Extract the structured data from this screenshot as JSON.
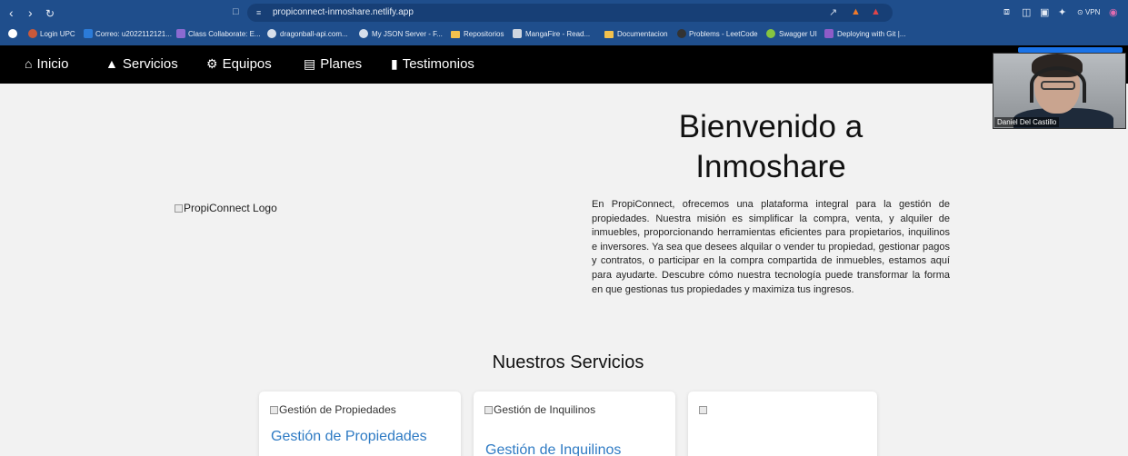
{
  "browser": {
    "url": "propiconnect-inmoshare.netlify.app",
    "vpn_label": "VPN",
    "bookmarks": [
      "Login UPC",
      "Correo: u2022112121...",
      "Class Collaborate: E...",
      "dragonball-api.com...",
      "My JSON Server - F...",
      "Repositorios",
      "MangaFire - Read...",
      "Documentacion",
      "Problems - LeetCode",
      "Swagger UI",
      "Deploying with Git |..."
    ]
  },
  "nav": {
    "items": [
      {
        "label": "Inicio",
        "icon": "home-icon"
      },
      {
        "label": "Servicios",
        "icon": "bell-icon"
      },
      {
        "label": "Equipos",
        "icon": "gears-icon"
      },
      {
        "label": "Planes",
        "icon": "list-icon"
      },
      {
        "label": "Testimonios",
        "icon": "comment-icon"
      }
    ]
  },
  "webcam": {
    "name": "Daniel Del Castillo"
  },
  "hero": {
    "title": "Bienvenido a Inmoshare",
    "logo_alt": "PropiConnect Logo",
    "description": "En PropiConnect, ofrecemos una plataforma integral para la gestión de propiedades. Nuestra misión es simplificar la compra, venta, y alquiler de inmuebles, proporcionando herramientas eficientes para propietarios, inquilinos e inversores. Ya sea que desees alquilar o vender tu propiedad, gestionar pagos y contratos, o participar en la compra compartida de inmuebles, estamos aquí para ayudarte. Descubre cómo nuestra tecnología puede transformar la forma en que gestionas tus propiedades y maximiza tus ingresos."
  },
  "services": {
    "title": "Nuestros Servicios",
    "cards": [
      {
        "img_alt": "Gestión de Propiedades",
        "title": "Gestión de Propiedades"
      },
      {
        "img_alt": "Gestión de Inquilinos",
        "title": "Gestión de Inquilinos"
      },
      {
        "img_alt": "",
        "title": ""
      }
    ]
  }
}
